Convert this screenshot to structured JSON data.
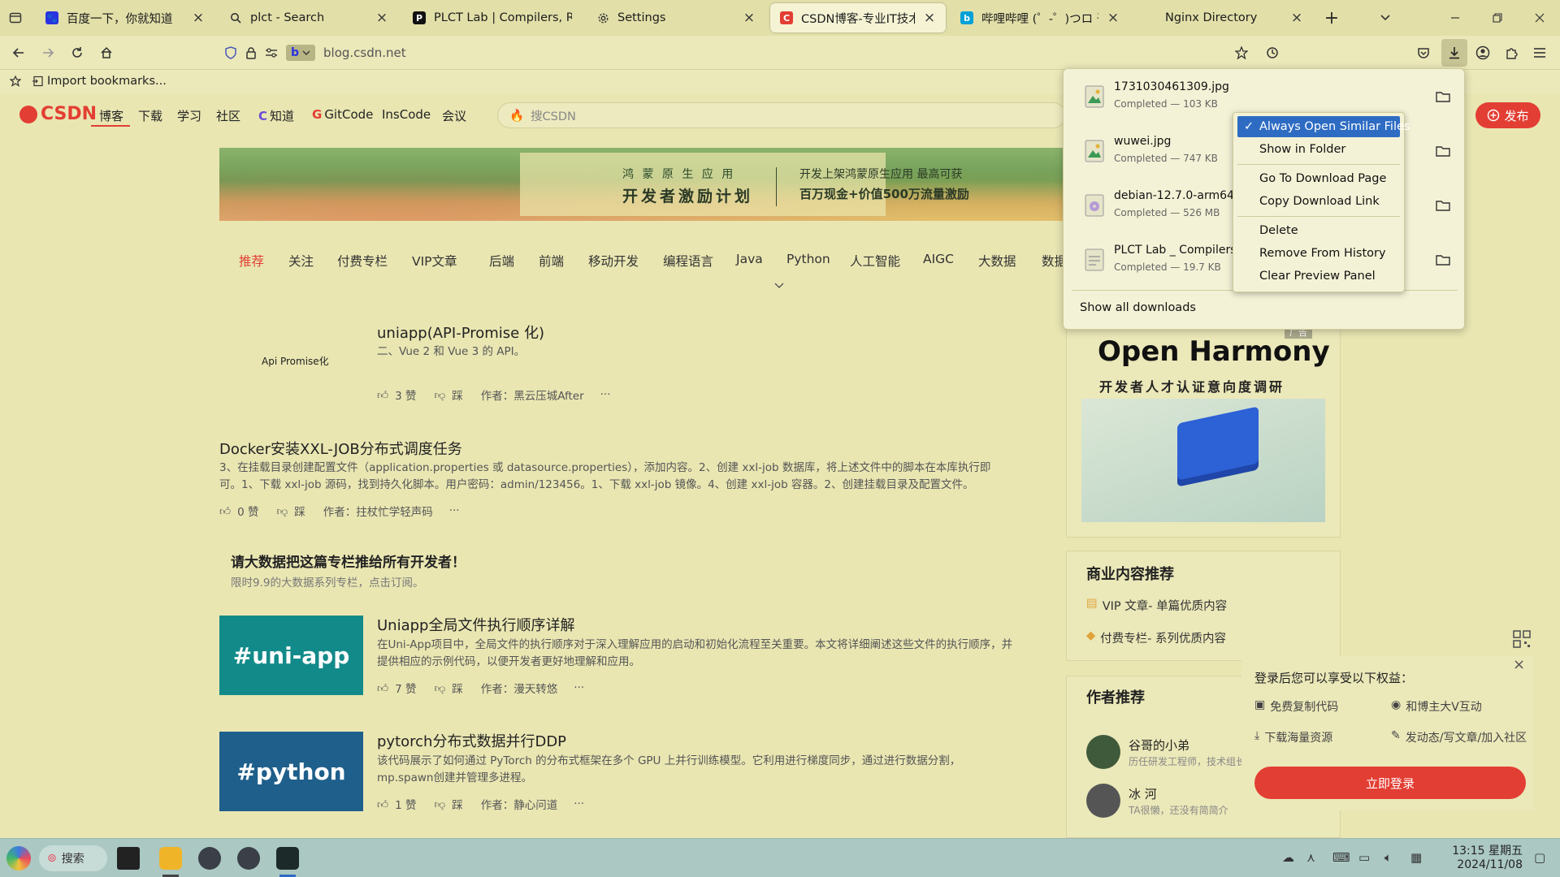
{
  "tabs": [
    {
      "title": "百度一下，你就知道",
      "icon": "baidu-paw-icon",
      "color": "#2932e1"
    },
    {
      "title": "plct - Search",
      "icon": "search-icon",
      "color": "#333333"
    },
    {
      "title": "PLCT Lab | Compilers, Runtim",
      "icon": "plct-icon",
      "color": "#111111"
    },
    {
      "title": "Settings",
      "icon": "gear-icon",
      "color": "#333333"
    },
    {
      "title": "CSDN博客-专业IT技术发表平台",
      "icon": "csdn-icon",
      "color": "#e33e33"
    },
    {
      "title": "哔哩哔哩 (゜-゜)つロ 干杯~-bil",
      "icon": "bilibili-icon",
      "color": "#00a1d6"
    },
    {
      "title": "Nginx Directory",
      "icon": "",
      "color": ""
    }
  ],
  "navbar": {
    "url": "blog.csdn.net"
  },
  "bookmarks": {
    "import_label": "Import bookmarks..."
  },
  "site": {
    "logo": "CSDN",
    "nav": [
      "博客",
      "下载",
      "学习",
      "社区",
      "知道",
      "GitCode",
      "InsCode",
      "会议"
    ],
    "search_placeholder": "搜CSDN",
    "publish": "发布",
    "banner": {
      "line1": "鸿 蒙 原 生 应 用",
      "line2": "开发者激励计划",
      "line3": "开发上架鸿蒙原生应用  最高可获",
      "line4": "百万现金+价值500万流量激励"
    },
    "categories": [
      "推荐",
      "关注",
      "付费专栏",
      "VIP文章",
      "后端",
      "前端",
      "移动开发",
      "编程语言",
      "Java",
      "Python",
      "人工智能",
      "AIGC",
      "大数据",
      "数据"
    ]
  },
  "articles": [
    {
      "title": "uniapp(API-Promise 化)",
      "desc": "二、Vue 2 和 Vue 3 的 API。",
      "thumb_text": "Api Promise化",
      "likes": "3 赞",
      "dislike": "踩",
      "author": "作者：黑云压城After",
      "more": "···"
    },
    {
      "title": "Docker安装XXL-JOB分布式调度任务",
      "desc": "3、在挂载目录创建配置文件（application.properties 或 datasource.properties），添加内容。2、创建 xxl-job 数据库，将上述文件中的脚本在本库执行即可。1、下载 xxl-job 源码，找到持久化脚本。用户密码：admin/123456。1、下载 xxl-job 镜像。4、创建 xxl-job 容器。2、创建挂载目录及配置文件。",
      "likes": "0 赞",
      "dislike": "踩",
      "author": "作者：拄杖忙学轻声码",
      "more": "···"
    },
    {
      "title": "Uniapp全局文件执行顺序详解",
      "desc": "在Uni-App项目中，全局文件的执行顺序对于深入理解应用的启动和初始化流程至关重要。本文将详细阐述这些文件的执行顺序，并提供相应的示例代码，以便开发者更好地理解和应用。",
      "thumb_text": "#uni-app",
      "likes": "7 赞",
      "dislike": "踩",
      "author": "作者：漫天转悠",
      "more": "···"
    },
    {
      "title": "pytorch分布式数据并行DDP",
      "desc": "该代码展示了如何通过 PyTorch 的分布式框架在多个 GPU 上并行训练模型。它利用进行梯度同步，通过进行数据分割，mp.spawn创建并管理多进程。",
      "thumb_text": "#python",
      "likes": "1 赞",
      "dislike": "踩",
      "author": "作者：静心问道",
      "more": "···"
    }
  ],
  "promo": {
    "title": "请大数据把这篇专栏推给所有开发者！",
    "sub": "限时9.9的大数据系列专栏，点击订阅。"
  },
  "sidebar": {
    "ad_badge": "广告",
    "ad_title": "Open Harmony",
    "ad_sub": "开发者人才认证意向度调研",
    "commercial_title": "商业内容推荐",
    "commercial_items": [
      "VIP 文章- 单篇优质内容",
      "付费专栏- 系列优质内容"
    ],
    "author_title": "作者推荐",
    "authors": [
      {
        "name": "谷哥的小弟",
        "desc": "历任研发工程师，技术组长"
      },
      {
        "name": "冰 河",
        "desc": "TA很懒，还没有简简介"
      }
    ]
  },
  "login_popup": {
    "title": "登录后您可以享受以下权益：",
    "benefits": [
      "免费复制代码",
      "和博主大V互动",
      "下载海量资源",
      "发动态/写文章/加入社区"
    ],
    "button": "立即登录",
    "close": "×"
  },
  "downloads": {
    "items": [
      {
        "name": "1731030461309.jpg",
        "status": "Completed — 103 KB",
        "icon": "image-file-icon"
      },
      {
        "name": "wuwei.jpg",
        "status": "Completed — 747 KB",
        "icon": "image-file-icon"
      },
      {
        "name": "debian-12.7.0-arm64-netinst.iso",
        "status": "Completed — 526 MB",
        "icon": "disc-file-icon"
      },
      {
        "name": "PLCT Lab _ Compilers, Runtimes.html",
        "status": "Completed — 19.7 KB",
        "icon": "web-file-icon"
      }
    ],
    "show_all": "Show all downloads"
  },
  "context_menu": [
    {
      "label": "Always Open Similar Files",
      "checked": true
    },
    {
      "label": "Show in Folder"
    },
    {
      "label": "Go To Download Page"
    },
    {
      "label": "Copy Download Link"
    },
    {
      "label": "Delete"
    },
    {
      "label": "Remove From History"
    },
    {
      "label": "Clear Preview Panel"
    }
  ],
  "taskbar": {
    "search_label": "搜索",
    "time": "13:15 星期五",
    "date": "2024/11/08"
  },
  "colors": {
    "csdn_red": "#e33e33",
    "accent_blue": "#2e6cc4",
    "page_bg": "#e9e6b2",
    "uniapp_teal": "#138a8a",
    "python_blue": "#1f5f8b"
  }
}
